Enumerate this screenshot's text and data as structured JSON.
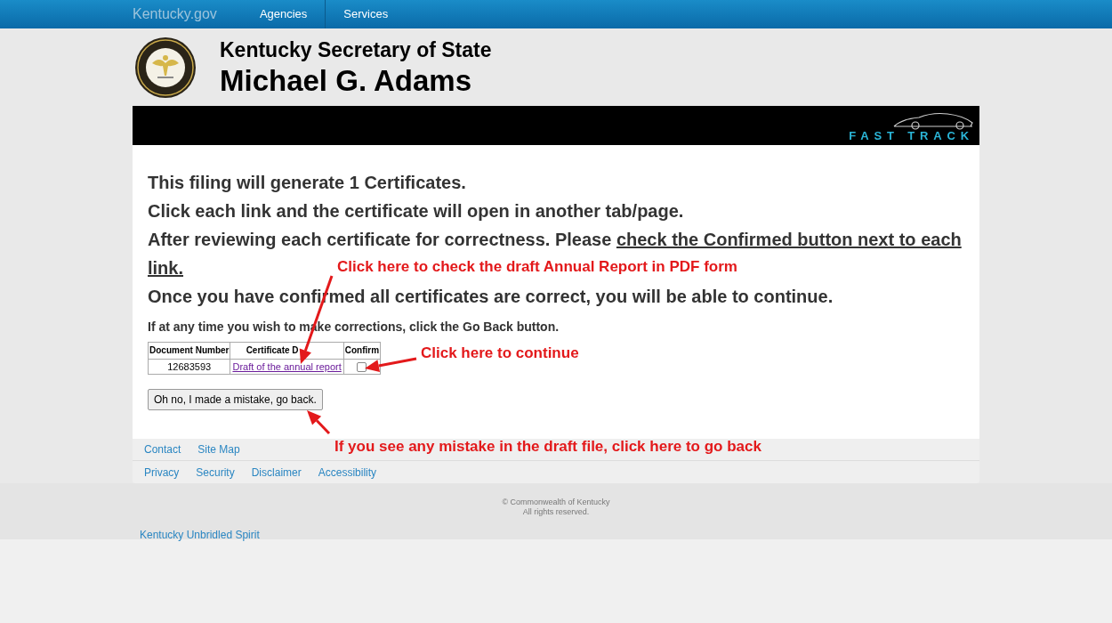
{
  "top_nav": {
    "brand": "Kentucky.gov",
    "items": [
      "Agencies",
      "Services"
    ]
  },
  "header": {
    "subtitle": "Kentucky Secretary of State",
    "name": "Michael G. Adams"
  },
  "banner": {
    "logo_text": "FAST TRACK"
  },
  "content": {
    "lines": [
      "This filing will generate 1 Certificates.",
      "Click each link and the certificate will open in another tab/page."
    ],
    "review": {
      "text": "After reviewing each certificate for correctness. Please ",
      "emphasis_line_1": "check the Confirmed button next to each",
      "emphasis_line_2": "link."
    },
    "confirm_line": "Once you have confirmed all certificates are correct, you will be able to continue.",
    "note": "If at any time you wish to make corrections, click the Go Back button.",
    "table": {
      "columns": [
        "Document Number",
        "Certificate D",
        "Confirm"
      ],
      "rows": [
        {
          "document_number": "12683593",
          "certificate": "Draft of the annual report",
          "visited": true,
          "checked": false
        }
      ]
    },
    "back_button": "Oh no, I made a mistake, go back."
  },
  "footer": {
    "links_row_1": [
      "Contact",
      "Site Map"
    ],
    "links_row_2": [
      "Privacy",
      "Security",
      "Disclaimer",
      "Accessibility"
    ],
    "copyright": [
      "© Commonwealth of Kentucky",
      "All rights reserved."
    ],
    "slogan": "Kentucky Unbridled Spirit"
  },
  "annotations": [
    {
      "text": "Click here to check the draft Annual Report in PDF form"
    },
    {
      "text": "Click here to continue"
    },
    {
      "text": "If you see any mistake in the draft file, click here to go back"
    }
  ]
}
